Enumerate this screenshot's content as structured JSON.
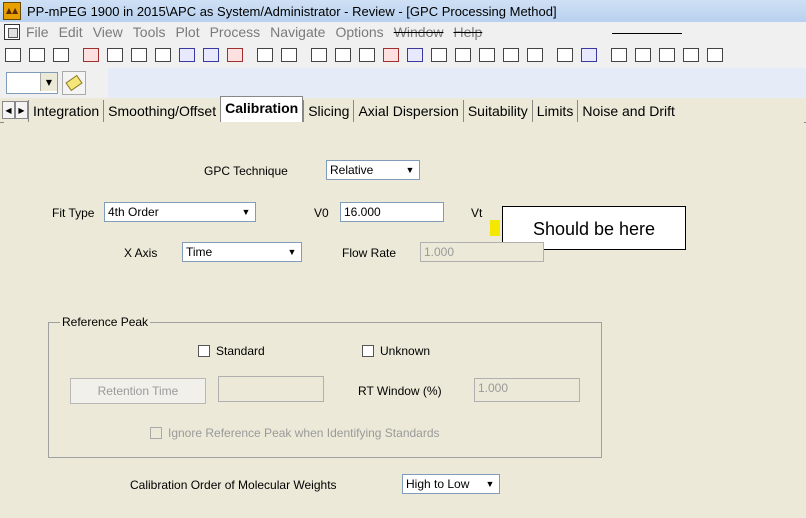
{
  "window": {
    "title": "PP-mPEG 1900 in 2015\\APC as System/Administrator - Review - [GPC Processing Method]"
  },
  "menu": [
    "File",
    "Edit",
    "View",
    "Tools",
    "Plot",
    "Process",
    "Navigate",
    "Options",
    "Window",
    "Help"
  ],
  "tabs": [
    "Integration",
    "Smoothing/Offset",
    "Calibration",
    "Slicing",
    "Axial Dispersion",
    "Suitability",
    "Limits",
    "Noise and Drift"
  ],
  "active_tab": "Calibration",
  "form": {
    "gpc_technique_label": "GPC Technique",
    "gpc_technique_value": "Relative",
    "fit_type_label": "Fit Type",
    "fit_type_value": "4th Order",
    "v0_label": "V0",
    "v0_value": "16.000",
    "vt_label": "Vt",
    "x_axis_label": "X Axis",
    "x_axis_value": "Time",
    "flow_rate_label": "Flow Rate",
    "flow_rate_value": "1.000",
    "reference_peak_label": "Reference Peak",
    "standard_label": "Standard",
    "unknown_label": "Unknown",
    "retention_time_button": "Retention Time",
    "rt_window_label": "RT Window (%)",
    "rt_window_value": "1.000",
    "ignore_ref_label": "Ignore Reference Peak when Identifying Standards",
    "calib_order_label": "Calibration Order of Molecular Weights",
    "calib_order_value": "High to Low"
  },
  "callout": {
    "text": "Should be here"
  },
  "colors": {
    "highlight": "#f5e800",
    "title_bg": "#c4d8f2"
  }
}
